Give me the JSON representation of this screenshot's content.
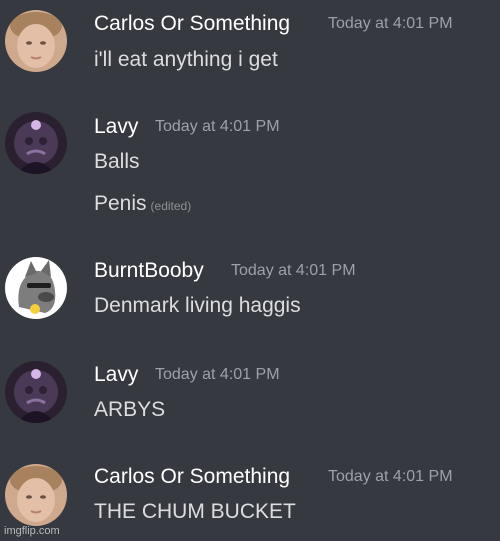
{
  "messages": [
    {
      "author": "Carlos Or Something",
      "timestamp": "Today at 4:01 PM",
      "lines": [
        "i'll eat anything i get"
      ]
    },
    {
      "author": "Lavy",
      "timestamp": "Today at 4:01 PM",
      "lines": [
        "Balls",
        "Penis"
      ],
      "edited_label": "(edited)"
    },
    {
      "author": "BurntBooby",
      "timestamp": "Today at 4:01 PM",
      "lines": [
        "Denmark living haggis"
      ]
    },
    {
      "author": "Lavy",
      "timestamp": "Today at 4:01 PM",
      "lines": [
        "ARBYS"
      ]
    },
    {
      "author": "Carlos Or Something",
      "timestamp": "Today at 4:01 PM",
      "lines": [
        "THE CHUM BUCKET"
      ]
    }
  ],
  "watermark": "imgflip.com",
  "colors": {
    "background": "#36393f",
    "username": "#ffffff",
    "message_text": "#dcddde",
    "timestamp": "#9ca1a8"
  }
}
